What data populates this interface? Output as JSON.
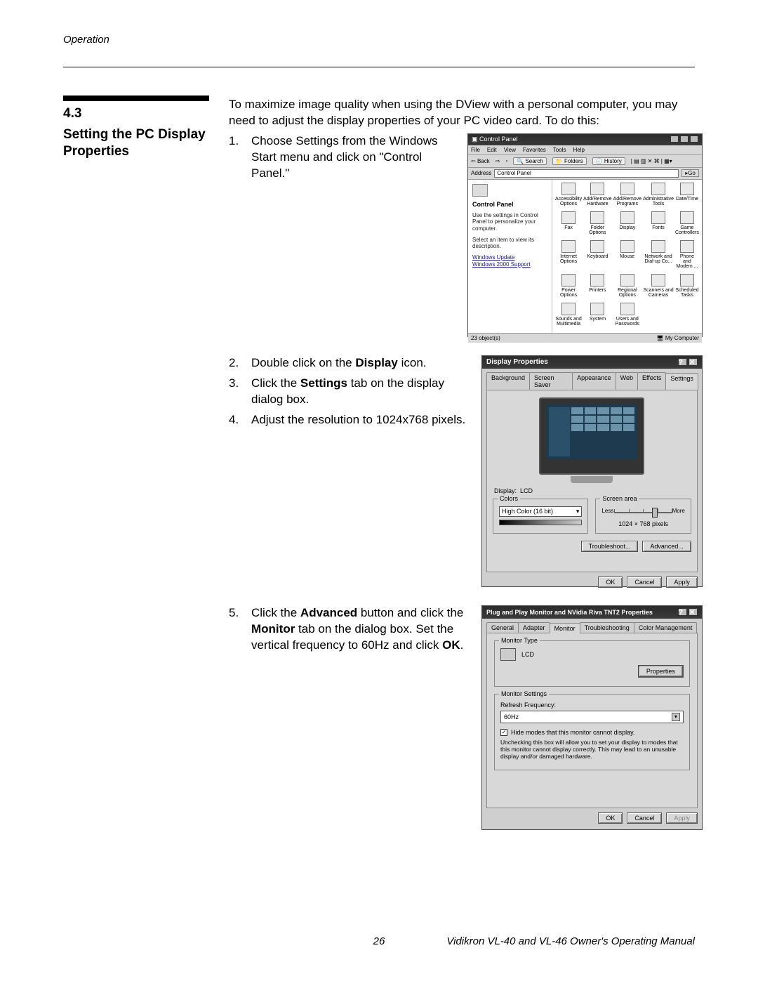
{
  "page": {
    "running_head": "Operation",
    "number": "26",
    "footer": "Vidikron VL-40 and VL-46 Owner's Operating Manual"
  },
  "section": {
    "num": "4.3",
    "title": "Setting the PC Display Properties",
    "intro": "To maximize image quality when using the DView with a personal computer, you may need to adjust the display properties of your PC video card. To do this:"
  },
  "steps": {
    "s1_num": "1.",
    "s1": "Choose Settings from the Windows Start menu and click on \"Control Panel.\"",
    "s2_num": "2.",
    "s2_pre": "Double click on the ",
    "s2_b": "Display",
    "s2_post": " icon.",
    "s3_num": "3.",
    "s3_pre": "Click the ",
    "s3_b": "Settings",
    "s3_post": " tab on the display dialog box.",
    "s4_num": "4.",
    "s4": "Adjust the resolution to 1024x768 pixels.",
    "s5_num": "5.",
    "s5_pre": "Click the ",
    "s5_b1": "Advanced",
    "s5_mid1": " button and click the ",
    "s5_b2": "Monitor",
    "s5_mid2": " tab on the dialog box. Set the vertical frequency to 60Hz and click ",
    "s5_b3": "OK",
    "s5_post": "."
  },
  "cp": {
    "title": "Control Panel",
    "menus": [
      "File",
      "Edit",
      "View",
      "Favorites",
      "Tools",
      "Help"
    ],
    "back": "Back",
    "search": "Search",
    "folders": "Folders",
    "history": "History",
    "addr_lbl": "Address",
    "addr_val": "Control Panel",
    "go": "Go",
    "left_h": "Control Panel",
    "left_desc": "Use the settings in Control Panel to personalize your computer.",
    "left_sel": "Select an item to view its description.",
    "left_lk1": "Windows Update",
    "left_lk2": "Windows 2000 Support",
    "icons": [
      "Accessibility Options",
      "Add/Remove Hardware",
      "Add/Remove Programs",
      "Administrative Tools",
      "Date/Time",
      "Fax",
      "Folder Options",
      "Display",
      "Fonts",
      "Game Controllers",
      "Internet Options",
      "Keyboard",
      "Mouse",
      "Network and Dial-up Co...",
      "Phone and Modem ...",
      "Power Options",
      "Printers",
      "Regional Options",
      "Scanners and Cameras",
      "Scheduled Tasks",
      "Sounds and Multimedia",
      "System",
      "Users and Passwords"
    ],
    "status_l": "23 object(s)",
    "status_r": "My Computer"
  },
  "dp": {
    "title": "Display Properties",
    "tabs": [
      "Background",
      "Screen Saver",
      "Appearance",
      "Web",
      "Effects",
      "Settings"
    ],
    "display_lbl": "Display:",
    "display_val": "LCD",
    "colors_lbl": "Colors",
    "colors_val": "High Color (16 bit)",
    "sa_lbl": "Screen area",
    "sa_less": "Less",
    "sa_more": "More",
    "sa_val": "1024 × 768 pixels",
    "troubleshoot": "Troubleshoot...",
    "advanced": "Advanced...",
    "ok": "OK",
    "cancel": "Cancel",
    "apply": "Apply"
  },
  "adv": {
    "title": "Plug and Play Monitor and NVidia Riva TNT2 Properties",
    "tabs": [
      "General",
      "Adapter",
      "Monitor",
      "Troubleshooting",
      "Color Management"
    ],
    "mt_lbl": "Monitor Type",
    "mt_val": "LCD",
    "properties": "Properties",
    "ms_lbl": "Monitor Settings",
    "rf_lbl": "Refresh Frequency:",
    "rf_val": "60Hz",
    "hide": "Hide modes that this monitor cannot display.",
    "warn": "Unchecking this box will allow you to set your display to modes that this monitor cannot display correctly. This may lead to an unusable display and/or damaged hardware.",
    "ok": "OK",
    "cancel": "Cancel",
    "apply": "Apply"
  }
}
